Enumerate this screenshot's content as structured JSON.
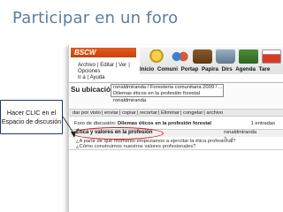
{
  "slide": {
    "title": "Participar en un foro"
  },
  "callout": {
    "line1": "Hacer CLIC en el",
    "line2": "Espacio de discusión"
  },
  "app": {
    "logo": "BSCW",
    "menu_row1": [
      "Archivo",
      "Editar",
      "Ver",
      "Opciones"
    ],
    "menu_row2": [
      "Ir a",
      "Ayuda"
    ],
    "toolbar": [
      "Inicio",
      "Comuni",
      "Portap",
      "Papira",
      "Dirs",
      "Agenda",
      "Tare"
    ]
  },
  "location": {
    "label": "Su ubicación:",
    "path_line1": "ronaldmiranda / Foresteria comunitaria 2009 / ...",
    "path_line2": "Dilemas éticos en la profesión forestal",
    "user": "ronaldmiranda"
  },
  "actions": [
    "dar por visto",
    "enviar",
    "copiar",
    "recortar",
    "Eliminar",
    "congelar",
    "archivo"
  ],
  "forum": {
    "header_prefix": "Foro de discusión:",
    "header_title": "Dilemas éticos en la profesión forestal",
    "entries": "1 entradas",
    "thread_title": "Ética y valores en la profesión",
    "author": "ronaldmiranda",
    "snippet1": "¿A partir de qué momento empezamos a ejercitar la ética profesional?",
    "snippet2": "¿Cómo construimos nuestros valores profesionales?"
  },
  "colors": {
    "title": "#5a7da0",
    "logo_bg": "#d5501a",
    "highlight": "#d01818",
    "callout_border": "#1d3a66"
  }
}
